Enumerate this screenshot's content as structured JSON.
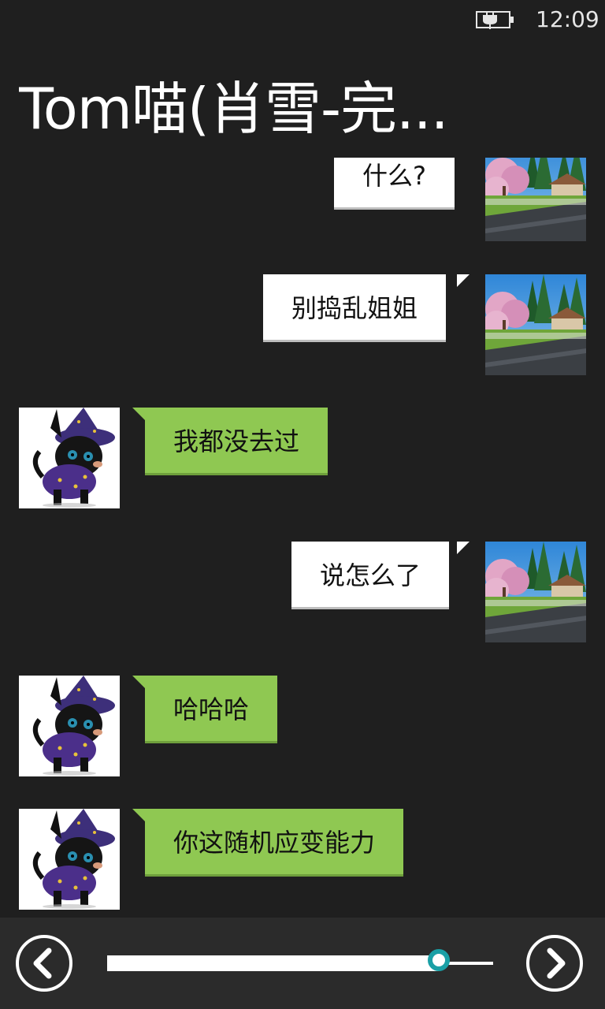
{
  "status": {
    "time": "12:09",
    "battery_icon": "battery-charging-icon"
  },
  "header": {
    "title": "Tom喵(肖雪-完..."
  },
  "messages": [
    {
      "sender": "self",
      "text": "什么?",
      "avatar": "landscape-avatar"
    },
    {
      "sender": "self",
      "text": "别捣乱姐姐",
      "avatar": "landscape-avatar"
    },
    {
      "sender": "other",
      "text": "我都没去过",
      "avatar": "black-cat-avatar"
    },
    {
      "sender": "self",
      "text": "说怎么了",
      "avatar": "landscape-avatar"
    },
    {
      "sender": "other",
      "text": "哈哈哈",
      "avatar": "black-cat-avatar"
    },
    {
      "sender": "other",
      "text": "你这随机应变能力",
      "avatar": "black-cat-avatar"
    }
  ],
  "toolbar": {
    "prev_icon": "chevron-left-icon",
    "next_icon": "chevron-right-icon",
    "slider_progress": 0.86,
    "accent_color": "#1aa0a6",
    "bubble_self_color": "#ffffff",
    "bubble_other_color": "#8fc852"
  }
}
